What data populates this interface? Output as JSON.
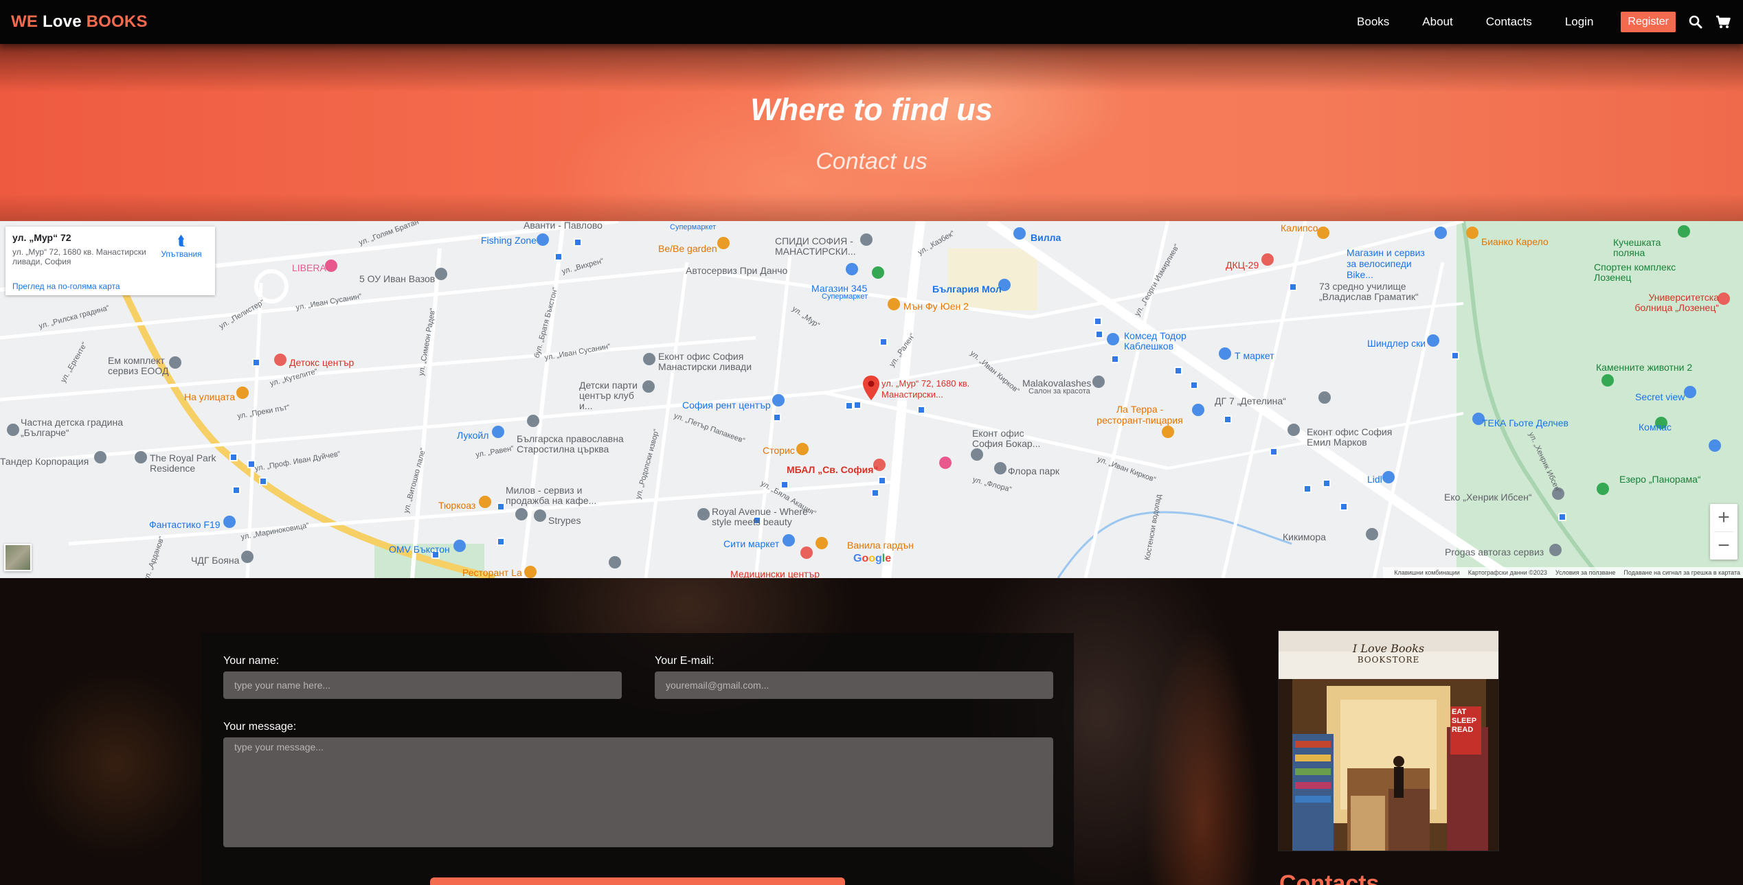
{
  "navbar": {
    "logo": {
      "part1": "WE",
      "part2": "Love",
      "part3": "BOOKS"
    },
    "links": [
      "Books",
      "About",
      "Contacts",
      "Login"
    ],
    "register": "Register",
    "icons": [
      "search-icon",
      "cart-icon"
    ]
  },
  "hero": {
    "title": "Where to find us",
    "subtitle": "Contact us"
  },
  "map": {
    "infocard": {
      "title": "ул. „Мур“ 72",
      "address": "ул. „Мур“ 72, 1680 кв. Манастирски ливади, София",
      "larger_map_link": "Преглед на по-голяма карта",
      "directions": "Упътвания"
    },
    "marker_label": "ул. „Мур“ 72, 1680 кв. Манастирски...",
    "places": [
      "Аванти - Павлово",
      "Fishing Zone",
      "Супермаркет",
      "Be/Be garden",
      "СПИДИ СОФИЯ - МАНАСТИРСКИ...",
      "Автосервиз При Данчо",
      "Магазин 345",
      "Супермаркет",
      "България Мол",
      "Вилла",
      "Калипсо",
      "ДКЦ-29",
      "Магазин и сервиз за велосипеди Bike...",
      "Бианко Карело",
      "Кучешката поляна",
      "Спортен комплекс Лозенец",
      "Университетска болница „Лозенец“",
      "LIBERA",
      "5 ОУ Иван Вазов",
      "73 средно училище „Владислав Граматик“",
      "Мън Фу Юен 2",
      "Комсед Тодор Каблешков",
      "Шиндлер ски",
      "Детокс център",
      "Ем комплект сервиз ЕООД",
      "Еконт офис София Манастирски ливади",
      "Т маркет",
      "Каменните животни 2",
      "Детски парти център клуб и...",
      "София рент център",
      "Malakovalashes",
      "Салон за красота",
      "ДГ 7 „Детелина“",
      "Secret view",
      "На улицата",
      "Ла Терра - ресторант-пицария",
      "ТЕКА Гьоте Делчев",
      "Частна детска градина „Българче“",
      "Лукойл",
      "Българска православна Старостилна църква",
      "Еконт офис София Бокар...",
      "Еконт офис София Емил Марков",
      "Компас",
      "Тандер Корпорация",
      "The Royal Park Residence",
      "Сторис",
      "МБАЛ „Св. София“",
      "Флора парк",
      "Lidl",
      "Езеро „Панорама“",
      "Тюркоаз",
      "Милов - сервиз и продажба на кафе...",
      "Strypes",
      "Royal Avenue - Where style meets beauty",
      "Еко „Хенрик Ибсен“",
      "Фантастико F19",
      "Сити маркет",
      "Ванила гардън",
      "Кикимора",
      "ОМV Бъкстон",
      "ЧДГ Бояна",
      "Ресторант La",
      "Медицински център",
      "Progas автогаз сервиз"
    ],
    "streets": [
      "ул. „Голям Братан“",
      "ул. „Вихрен“",
      "бул. „Братя Бъкстон“",
      "ул. „Казбек“",
      "ул. „Георги Измирлиев“",
      "ул. „Пелистер“",
      "ул. „Иван Сусанин“",
      "ул. „Симеон Радев“",
      "ул. „Иван Сусанин“",
      "ул. „Мур“",
      "ул. „Рилска градина“",
      "ул. „Ергенте“",
      "ул. „Кутелите“",
      "ул. „Преки път“",
      "ул. „Проф. Иван Дуйчев“",
      "ул. „Равен“",
      "ул. „Петър Папакеев“",
      "ул. „Родопски извор“",
      "ул. „Бяла Акация“",
      "ул. „Флора“",
      "ул. „Иван Кирков“",
      "ул. „Иван Кирков“",
      "ул. „Витошко лале“",
      "ул. „Мариноковица“",
      "ул. „Арданов“",
      "ул. „Хенрик Ибсен“",
      "Костенски водопад",
      "ул. „Рален“"
    ],
    "attribution": "Google",
    "footer": [
      "Клавишни комбинации",
      "Картографски данни ©2023",
      "Условия за ползване",
      "Подаване на сигнал за грешка в картата"
    ]
  },
  "contact_form": {
    "name_label": "Your name:",
    "name_placeholder": "type your name here...",
    "email_label": "Your E-mail:",
    "email_placeholder": "youremail@gmail.com...",
    "message_label": "Your message:",
    "message_placeholder": "type your message..."
  },
  "store_image": {
    "sign_line1": "I Love Books",
    "sign_line2": "BOOKSTORE",
    "poster": [
      "EAT",
      "SLEEP",
      "READ"
    ]
  },
  "contacts_heading": "Contacts",
  "colors": {
    "accent": "#f36a4f",
    "navbar": "#050505",
    "input_bg": "#5b5757"
  }
}
